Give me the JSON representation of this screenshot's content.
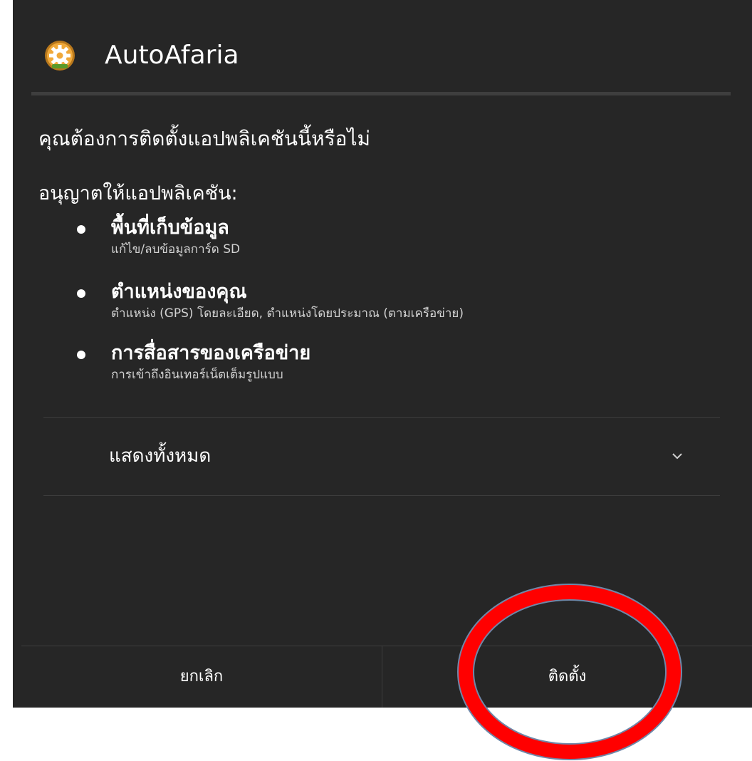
{
  "dialog": {
    "app_name": "AutoAfaria",
    "question": "คุณต้องการติดตั้งแอปพลิเคชันนี้หรือไม่",
    "permissions_label": "อนุญาตให้แอปพลิเคชัน:",
    "permissions": [
      {
        "title": "พื้นที่เก็บข้อมูล",
        "description": "แก้ไข/ลบข้อมูลการ์ด SD"
      },
      {
        "title": "ตำแหน่งของคุณ",
        "description": "ตำแหน่ง (GPS) โดยละเอียด, ตำแหน่งโดยประมาณ (ตามเครือข่าย)"
      },
      {
        "title": "การสื่อสารของเครือข่าย",
        "description": "การเข้าถึงอินเทอร์เน็ตเต็มรูปแบบ"
      }
    ],
    "show_all_label": "แสดงทั้งหมด",
    "cancel_label": "ยกเลิก",
    "install_label": "ติดตั้ง"
  },
  "icons": {
    "app": "gear-app-icon",
    "expand": "chevron-down-icon",
    "bullet": "bullet-dot"
  },
  "colors": {
    "dialog_background": "#262626",
    "text": "#ffffff",
    "secondary_text": "#d2d2d2",
    "divider": "#3d3d3d",
    "annotation_ring": "#ff0000"
  }
}
